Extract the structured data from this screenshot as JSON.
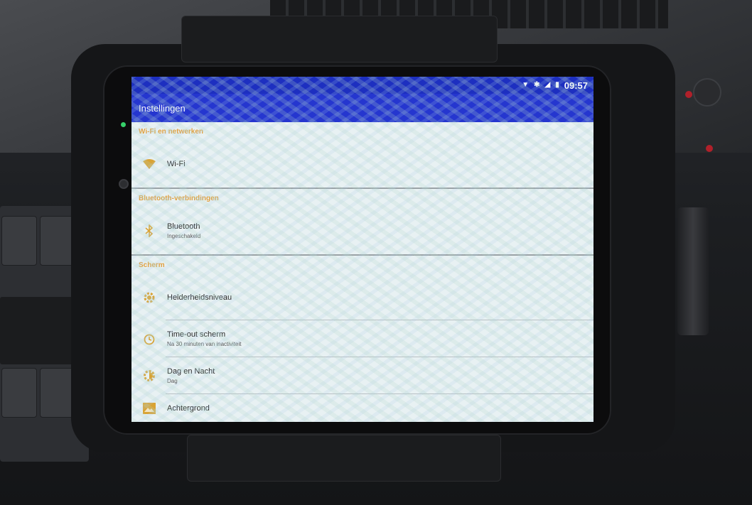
{
  "status_bar": {
    "location_icon": "location-pin-icon",
    "bluetooth_icon": "bluetooth-icon",
    "signal_icon": "no-signal-icon",
    "battery_icon": "battery-icon",
    "time": "09:57"
  },
  "toolbar": {
    "title": "Instellingen"
  },
  "sections": [
    {
      "header": "Wi-Fi en netwerken",
      "items": [
        {
          "icon": "wifi-icon",
          "title": "Wi-Fi",
          "subtitle": ""
        }
      ]
    },
    {
      "header": "Bluetooth-verbindingen",
      "items": [
        {
          "icon": "bluetooth-icon",
          "title": "Bluetooth",
          "subtitle": "Ingeschakeld"
        }
      ]
    },
    {
      "header": "Scherm",
      "items": [
        {
          "icon": "brightness-icon",
          "title": "Helderheidsniveau",
          "subtitle": ""
        },
        {
          "icon": "timer-icon",
          "title": "Time-out scherm",
          "subtitle": "Na 30 minuten van inactiviteit"
        },
        {
          "icon": "day-night-icon",
          "title": "Dag en Nacht",
          "subtitle": "Dag"
        },
        {
          "icon": "wallpaper-icon",
          "title": "Achtergrond",
          "subtitle": ""
        }
      ]
    }
  ],
  "colors": {
    "statusbar": "#1d2fc0",
    "toolbar": "#2536cf",
    "accent": "#e0a040",
    "icon": "#d9a334"
  }
}
